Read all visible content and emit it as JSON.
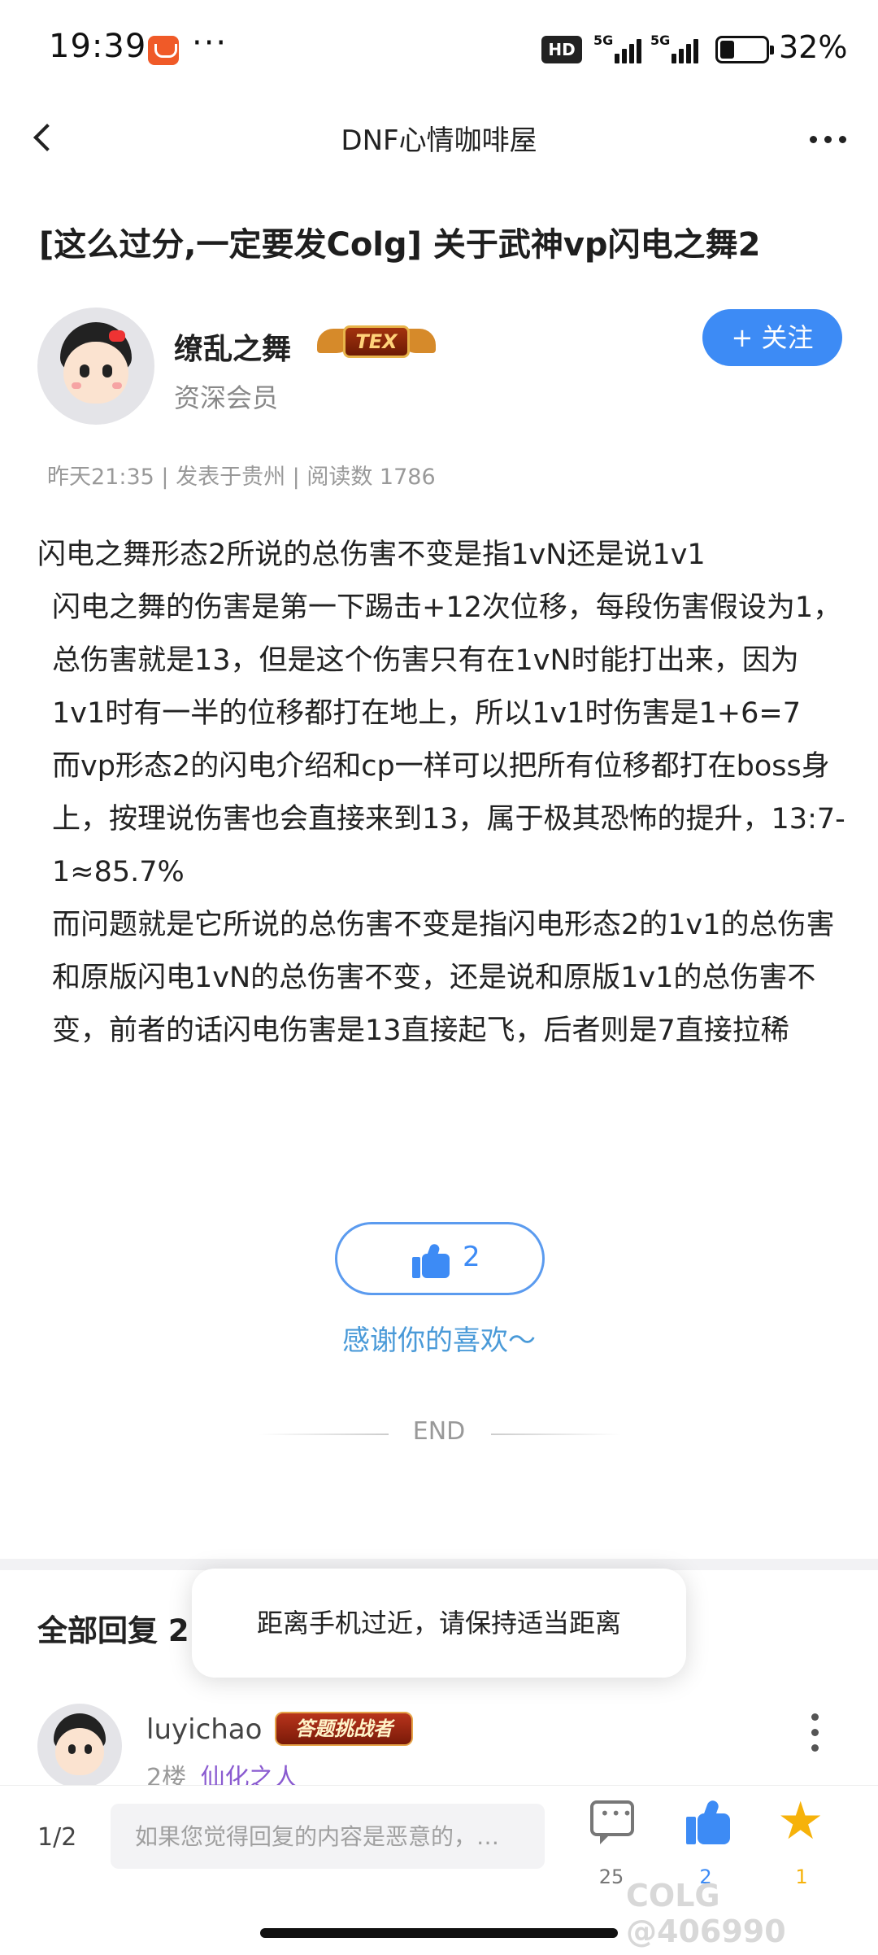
{
  "status_bar": {
    "time": "19:39",
    "dots": "···",
    "hd": "HD",
    "signal1": "5G",
    "signal2": "5G",
    "battery_pct": "32%",
    "battery_level": 0.32
  },
  "header": {
    "title": "DNF心情咖啡屋"
  },
  "post": {
    "title": "[这么过分,一定要发Colg] 关于武神vp闪电之舞2",
    "author": {
      "name": "缭乱之舞",
      "badge": "TEX",
      "role": "资深会员",
      "follow_label": "+ 关注"
    },
    "meta": "昨天21:35 | 发表于贵州 | 阅读数 1786",
    "body": [
      "闪电之舞形态2所说的总伤害不变是指1vN还是说1v1",
      "闪电之舞的伤害是第一下踢击+12次位移，每段伤害假设为1，总伤害就是13，但是这个伤害只有在1vN时能打出来，因为1v1时有一半的位移都打在地上，所以1v1时伤害是1+6=7",
      "而vp形态2的闪电介绍和cp一样可以把所有位移都打在boss身上，按理说伤害也会直接来到13，属于极其恐怖的提升，13:7-1≈85.7%",
      "而问题就是它所说的总伤害不变是指闪电形态2的1v1的总伤害和原版闪电1vN的总伤害不变，还是说和原版1v1的总伤害不变，前者的话闪电伤害是13直接起飞，后者则是7直接拉稀"
    ],
    "like_count": "2",
    "thanks": "感谢你的喜欢～",
    "end": "END"
  },
  "replies": {
    "title": "全部回复 2",
    "toast": "距离手机过近，请保持适当距离",
    "first": {
      "name": "luyichao",
      "badge": "答题挑战者",
      "floor": "2楼",
      "user_title": "仙化之人"
    }
  },
  "bottom_bar": {
    "page_indicator": "1/2",
    "reply_placeholder": "如果您觉得回复的内容是恶意的，…",
    "comment_count": "25",
    "like_count": "2",
    "fav_count": "1"
  },
  "watermark": "COLG @406990",
  "colors": {
    "accent": "#3d8bf5",
    "thanks": "#4a9ad8",
    "star": "#f6b20a"
  }
}
